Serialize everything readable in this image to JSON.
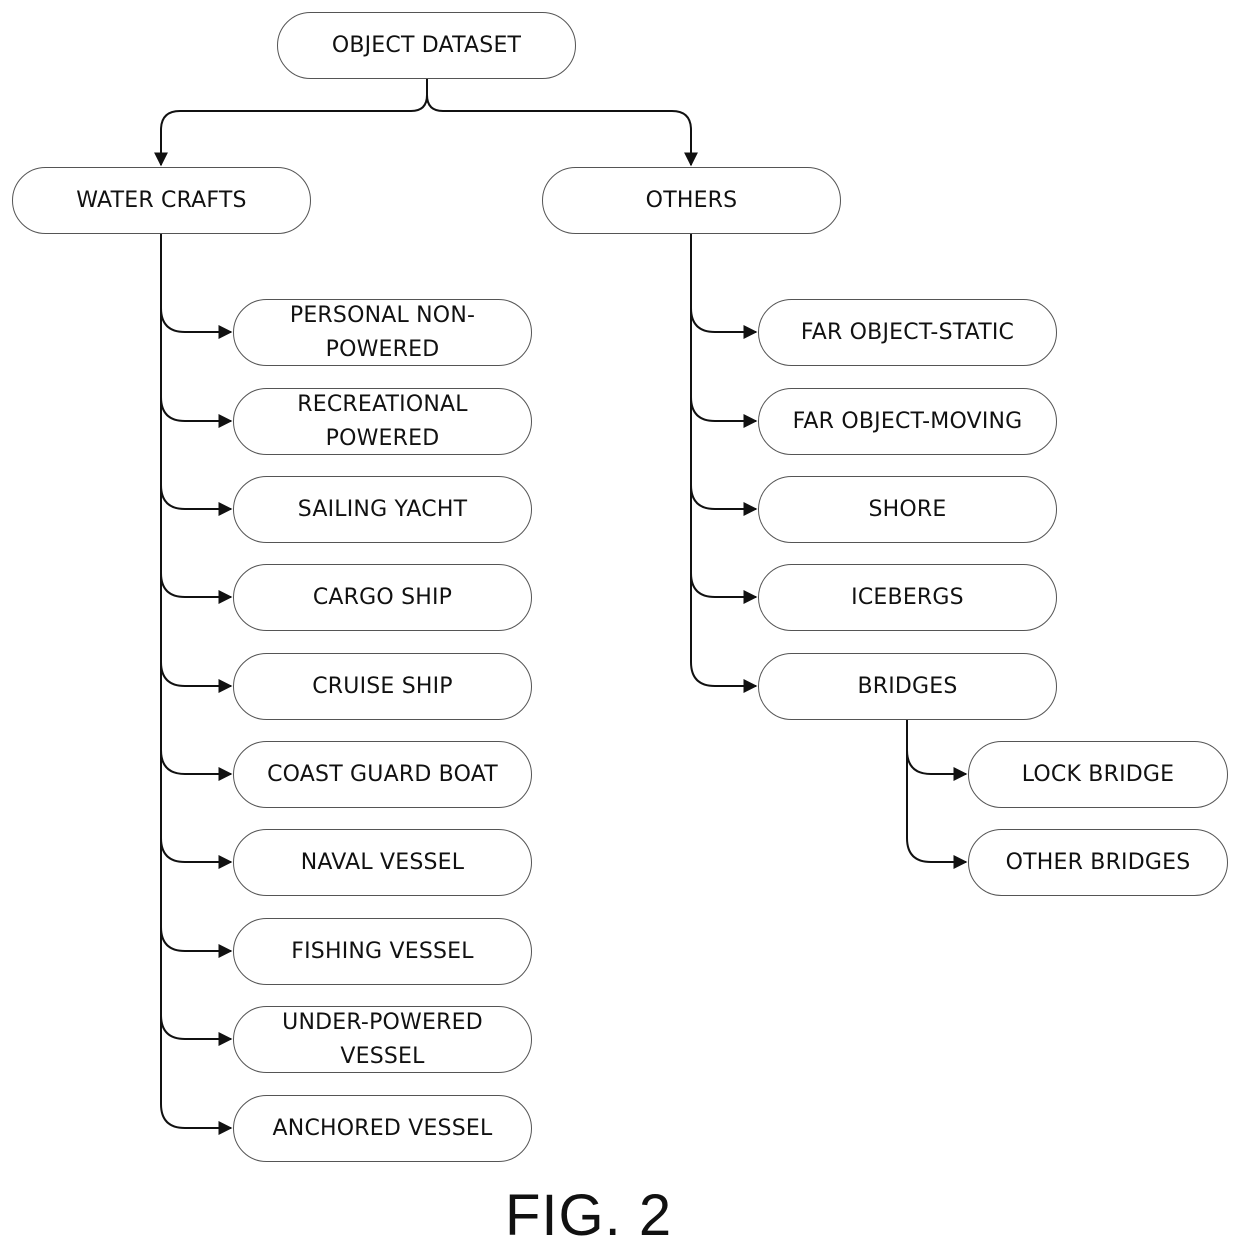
{
  "diagram": {
    "root": {
      "label": "OBJECT DATASET"
    },
    "branches": [
      {
        "label": "WATER CRAFTS",
        "children": [
          {
            "label": "PERSONAL NON-\nPOWERED"
          },
          {
            "label": "RECREATIONAL\nPOWERED"
          },
          {
            "label": "SAILING YACHT"
          },
          {
            "label": "CARGO SHIP"
          },
          {
            "label": "CRUISE SHIP"
          },
          {
            "label": "COAST GUARD BOAT"
          },
          {
            "label": "NAVAL VESSEL"
          },
          {
            "label": "FISHING VESSEL"
          },
          {
            "label": "UNDER-POWERED\nVESSEL"
          },
          {
            "label": "ANCHORED VESSEL"
          }
        ]
      },
      {
        "label": "OTHERS",
        "children": [
          {
            "label": "FAR OBJECT-STATIC"
          },
          {
            "label": "FAR OBJECT-MOVING"
          },
          {
            "label": "SHORE"
          },
          {
            "label": "ICEBERGS"
          },
          {
            "label": "BRIDGES",
            "children": [
              {
                "label": "LOCK BRIDGE"
              },
              {
                "label": "OTHER BRIDGES"
              }
            ]
          }
        ]
      }
    ]
  },
  "caption": "FIG. 2",
  "colors": {
    "stroke": "#111111",
    "border": "#555555",
    "background": "#ffffff"
  }
}
